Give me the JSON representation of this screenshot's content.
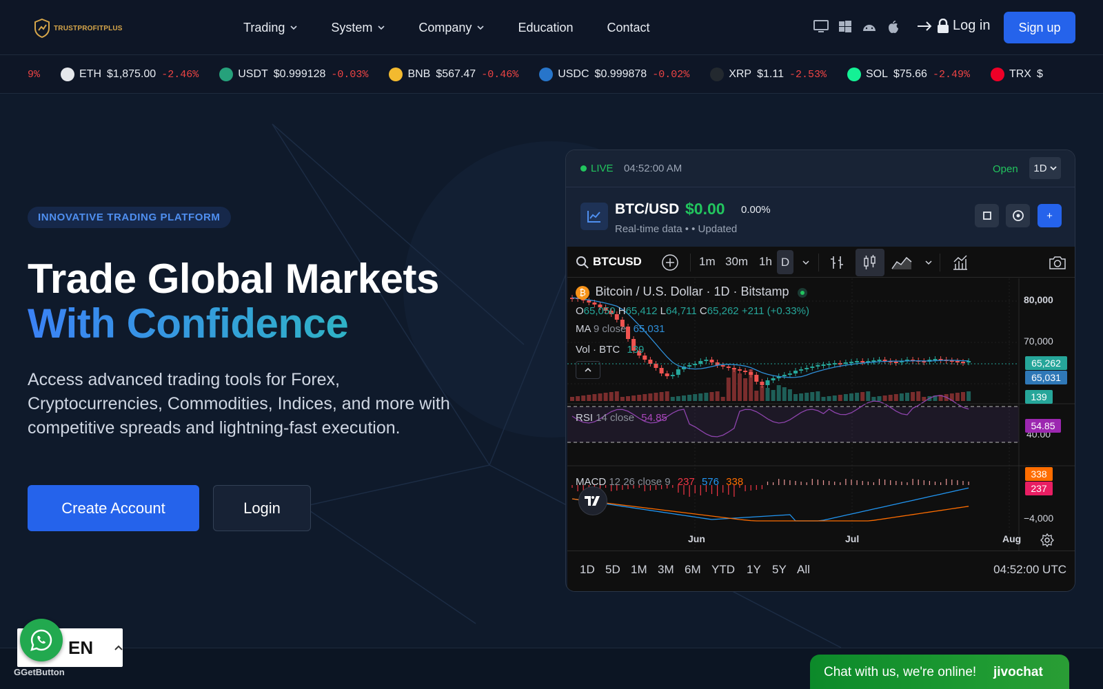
{
  "brand": {
    "name": "TRUSTPROFITPLUS"
  },
  "nav": {
    "menu": [
      {
        "label": "Trading",
        "dropdown": true
      },
      {
        "label": "System",
        "dropdown": true
      },
      {
        "label": "Company",
        "dropdown": true
      },
      {
        "label": "Education",
        "dropdown": false
      },
      {
        "label": "Contact",
        "dropdown": false
      }
    ],
    "platforms": [
      "desktop-icon",
      "windows-icon",
      "android-icon",
      "apple-icon"
    ],
    "login_label": "Log in",
    "signup_label": "Sign up"
  },
  "ticker": [
    {
      "symbol": "",
      "price": "",
      "change": "9%",
      "icon": "",
      "color": ""
    },
    {
      "symbol": "ETH",
      "price": "$1,875.00",
      "change": "-2.46%",
      "icon": "eth-icon",
      "color": "#e5e7eb"
    },
    {
      "symbol": "USDT",
      "price": "$0.999128",
      "change": "-0.03%",
      "icon": "usdt-icon",
      "color": "#26a17b"
    },
    {
      "symbol": "BNB",
      "price": "$567.47",
      "change": "-0.46%",
      "icon": "bnb-icon",
      "color": "#f3ba2f"
    },
    {
      "symbol": "USDC",
      "price": "$0.999878",
      "change": "-0.02%",
      "icon": "usdc-icon",
      "color": "#2775ca"
    },
    {
      "symbol": "XRP",
      "price": "$1.11",
      "change": "-2.53%",
      "icon": "xrp-icon",
      "color": "#23292f"
    },
    {
      "symbol": "SOL",
      "price": "$75.66",
      "change": "-2.49%",
      "icon": "sol-icon",
      "color": "#14f195"
    },
    {
      "symbol": "TRX",
      "price": "$",
      "change": "",
      "icon": "trx-icon",
      "color": "#ef0027"
    }
  ],
  "hero": {
    "badge": "INNOVATIVE TRADING PLATFORM",
    "title_line1": "Trade Global Markets",
    "title_line2": "With Confidence",
    "description": "Access advanced trading tools for Forex, Cryptocurrencies, Commodities, Indices, and more with competitive spreads and lightning-fast execution.",
    "create_label": "Create Account",
    "login_label": "Login"
  },
  "panel": {
    "live": "LIVE",
    "time": "04:52:00 AM",
    "status": "Open",
    "timeframe": "1D",
    "pair": "BTC/USD",
    "price": "$0.00",
    "change": "0.00%",
    "realtime": "Real-time data •",
    "updated": "• Updated",
    "add_label": "+"
  },
  "tv": {
    "symbol": "BTCUSD",
    "intervals": [
      "1m",
      "30m",
      "1h",
      "D"
    ],
    "title": "Bitcoin / U.S. Dollar · 1D · Bitstamp",
    "ohlc": {
      "o": "65,050",
      "h": "65,412",
      "l": "64,711",
      "c": "65,262",
      "change": "+211 (+0.33%)"
    },
    "ma": {
      "label": "MA",
      "params": "9 close",
      "value": "65,031"
    },
    "vol": {
      "label": "Vol · BTC",
      "value": "139"
    },
    "rsi": {
      "label": "RSI",
      "params": "14 close",
      "value": "54.85"
    },
    "macd": {
      "label": "MACD",
      "params": "12 26 close 9",
      "v1": "237",
      "v2": "576",
      "v3": "338"
    },
    "price_axis": [
      "80,000",
      "70,000",
      "40.00",
      "−4,000"
    ],
    "tags": {
      "close": "65,262",
      "ma": "65,031",
      "vol": "139",
      "rsi": "54.85",
      "macd_a": "338",
      "macd_b": "237"
    },
    "time_axis": [
      "Jun",
      "Jul",
      "Aug"
    ],
    "ranges": [
      "1D",
      "5D",
      "1M",
      "3M",
      "6M",
      "YTD",
      "1Y",
      "5Y",
      "All"
    ],
    "utc": "04:52:00 UTC"
  },
  "widgets": {
    "lang": "EN",
    "getbutton": "GetButton",
    "chat_text": "Chat with us, we're online!",
    "chat_brand": "jivochat"
  }
}
